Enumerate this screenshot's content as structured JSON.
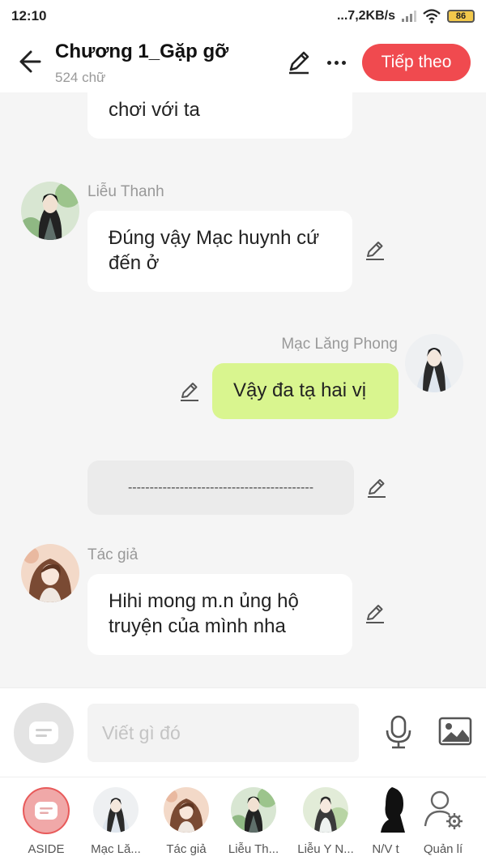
{
  "status_bar": {
    "time": "12:10",
    "network": "...7,2KB/s",
    "battery": "86"
  },
  "header": {
    "title": "Chương 1_Gặp gỡ",
    "subtitle": "524 chữ",
    "next_label": "Tiếp theo"
  },
  "messages": {
    "m0": {
      "text": "chơi với ta"
    },
    "m1": {
      "sender": "Liễu Thanh",
      "text": "Đúng vậy Mạc huynh cứ đến ở"
    },
    "m2": {
      "sender": "Mạc Lăng Phong",
      "text": "Vậy đa tạ hai vị"
    },
    "m3": {
      "text": "-------------------------------------------"
    },
    "m4": {
      "sender": "Tác giả",
      "text": "Hihi mong m.n ủng hộ truyện của mình nha"
    }
  },
  "composer": {
    "placeholder": "Viết gì đó"
  },
  "characters": [
    {
      "label": "ASIDE"
    },
    {
      "label": "Mạc Lă..."
    },
    {
      "label": "Tác giả"
    },
    {
      "label": "Liễu Th..."
    },
    {
      "label": "Liễu Y N..."
    },
    {
      "label": "N/V t"
    },
    {
      "label": "Quản lí"
    }
  ],
  "colors": {
    "accent": "#f04a4f",
    "own_bubble": "#d9f58f",
    "background": "#f5f5f5"
  }
}
